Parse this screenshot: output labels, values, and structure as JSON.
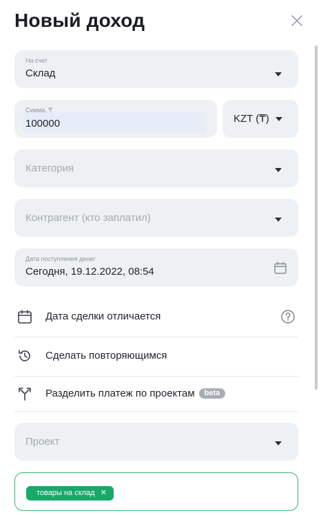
{
  "dialog": {
    "title": "Новый доход"
  },
  "account": {
    "label": "На счет",
    "value": "Склад"
  },
  "amount": {
    "label": "Сумма, ₸",
    "value": "100000"
  },
  "currency": {
    "value": "KZT (₸)"
  },
  "category": {
    "placeholder": "Категория"
  },
  "counterparty": {
    "placeholder": "Контрагент (кто заплатил)"
  },
  "date": {
    "label": "Дата поступления денег",
    "value": "Сегодня, 19.12.2022, 08:54"
  },
  "options": {
    "deal_date": "Дата сделки отличается",
    "recurring": "Сделать повторяющимся",
    "split": "Разделить платеж по проектам",
    "split_badge": "beta"
  },
  "project": {
    "placeholder": "Проект"
  },
  "tags": [
    "товары на склад"
  ],
  "icons": {
    "close": "close-icon",
    "calendar": "calendar-icon",
    "help": "help-icon",
    "history": "history-icon",
    "split": "split-icon"
  },
  "colors": {
    "accent": "#1aa869",
    "field_bg": "#eef1f3",
    "tag_border": "#33b36b"
  }
}
